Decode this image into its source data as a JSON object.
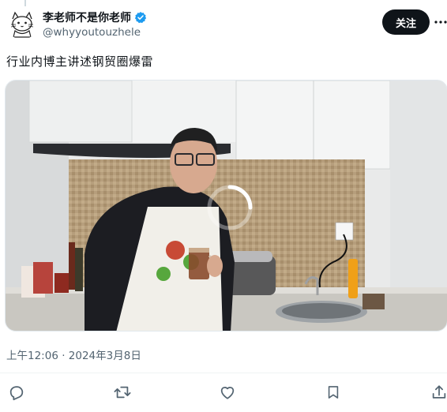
{
  "author": {
    "display_name": "李老师不是你老师",
    "handle": "@whyyoutouzhele",
    "verified": true,
    "avatar_icon": "cat-doodle-avatar"
  },
  "follow_label": "关注",
  "post": {
    "text": "行业内博主讲述钢贸圈爆雷",
    "media_type": "video",
    "media_state": "loading"
  },
  "timestamp": "上午12:06 · 2024年3月8日",
  "actions": [
    {
      "name": "reply-icon"
    },
    {
      "name": "retweet-icon"
    },
    {
      "name": "like-icon"
    },
    {
      "name": "bookmark-icon"
    },
    {
      "name": "share-icon"
    }
  ],
  "colors": {
    "text_primary": "#0f1419",
    "text_secondary": "#536471",
    "verified_blue": "#1d9bf0",
    "follow_bg": "#0f1419"
  }
}
